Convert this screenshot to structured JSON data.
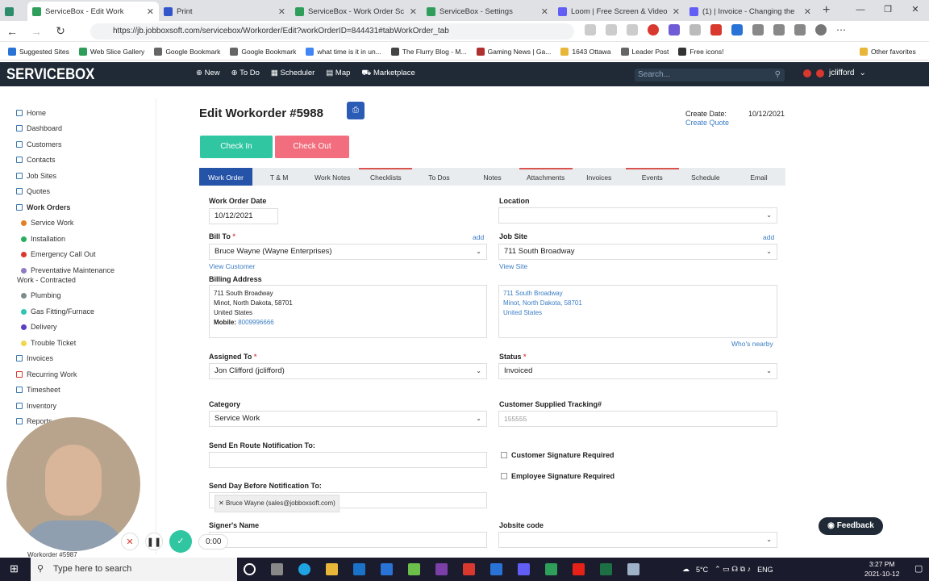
{
  "browser": {
    "tabs": [
      {
        "label": ""
      },
      {
        "label": "ServiceBox - Edit Work"
      },
      {
        "label": "Print"
      },
      {
        "label": "ServiceBox - Work Order Sc"
      },
      {
        "label": "ServiceBox - Settings"
      },
      {
        "label": "Loom | Free Screen & Video"
      },
      {
        "label": "(1) | Invoice - Changing the"
      }
    ],
    "url": "https://jb.jobboxsoft.com/servicebox/Workorder/Edit?workOrderID=844431#tabWorkOrder_tab",
    "bookmarks": [
      "Suggested Sites",
      "Web Slice Gallery",
      "Google Bookmark",
      "Google Bookmark",
      "what time is it in un...",
      "The Flurry Blog - M...",
      "Gaming News | Ga...",
      "1643 Ottawa",
      "Leader Post",
      "Free icons!"
    ],
    "other_favorites": "Other favorites"
  },
  "header": {
    "logo": "SERVICEBOX",
    "nav": [
      "New",
      "To Do",
      "Scheduler",
      "Map",
      "Marketplace"
    ],
    "search_placeholder": "Search...",
    "username": "jclifford"
  },
  "sidebar": {
    "items": [
      "Home",
      "Dashboard",
      "Customers",
      "Contacts",
      "Job Sites",
      "Quotes",
      "Work Orders"
    ],
    "workorder_types": [
      {
        "label": "Service Work",
        "color": "#e67e22"
      },
      {
        "label": "Installation",
        "color": "#27ae60"
      },
      {
        "label": "Emergency Call Out",
        "color": "#d9382e"
      },
      {
        "label": "Preventative Maintenance",
        "color": "#8e7cc3"
      },
      {
        "label": "Plumbing",
        "color": "#7f8c8d"
      },
      {
        "label": "Gas Fitting/Furnace",
        "color": "#2ec4b6"
      },
      {
        "label": "Delivery",
        "color": "#5b3fc4"
      },
      {
        "label": "Trouble Ticket",
        "color": "#f1d54b"
      }
    ],
    "pm_sub": "Work - Contracted",
    "items_after": [
      "Invoices",
      "Recurring Work",
      "Timesheet",
      "Inventory",
      "Reports"
    ],
    "bottom_item": "Workorder #5987"
  },
  "page": {
    "title": "Edit Workorder #5988",
    "create_date_label": "Create Date:",
    "create_date": "10/12/2021",
    "create_quote": "Create Quote",
    "checkin": "Check In",
    "checkout": "Check Out",
    "tabs": [
      "Work Order",
      "T & M",
      "Work Notes",
      "Checklists",
      "To Dos",
      "Notes",
      "Attachments",
      "Invoices",
      "Events",
      "Schedule",
      "Email"
    ]
  },
  "form": {
    "wo_date_label": "Work Order Date",
    "wo_date": "10/12/2021",
    "location_label": "Location",
    "location": "",
    "billto_label": "Bill To",
    "billto": "Bruce Wayne (Wayne Enterprises)",
    "add": "add",
    "view_customer": "View Customer",
    "jobsite_label": "Job Site",
    "jobsite": "711 South Broadway",
    "view_site": "View Site",
    "billing_address_label": "Billing Address",
    "billing_address": [
      "711 South Broadway",
      "Minot, North Dakota, 58701",
      "United States"
    ],
    "mobile_label": "Mobile:",
    "mobile": "8009996666",
    "site_address": [
      "711 South Broadway",
      "Minot, North Dakota, 58701",
      "United States"
    ],
    "whos_nearby": "Who's nearby",
    "assigned_label": "Assigned To",
    "assigned": "Jon Clifford (jclifford)",
    "status_label": "Status",
    "status": "Invoiced",
    "category_label": "Category",
    "category": "Service Work",
    "tracking_label": "Customer Supplied Tracking#",
    "tracking": "155555",
    "enroute_label": "Send En Route Notification To:",
    "cust_sig": "Customer Signature Required",
    "emp_sig": "Employee Signature Required",
    "daybefore_label": "Send Day Before Notification To:",
    "daybefore_tag": "Bruce Wayne (sales@jobboxsoft.com)",
    "signer_label": "Signer's Name",
    "jobsite_code_label": "Jobsite code"
  },
  "feedback": "Feedback",
  "recorder": {
    "time": "0:00"
  },
  "taskbar": {
    "search_placeholder": "Type here to search",
    "weather": "5°C",
    "lang": "ENG",
    "time": "3:27 PM",
    "date": "2021-10-12"
  }
}
